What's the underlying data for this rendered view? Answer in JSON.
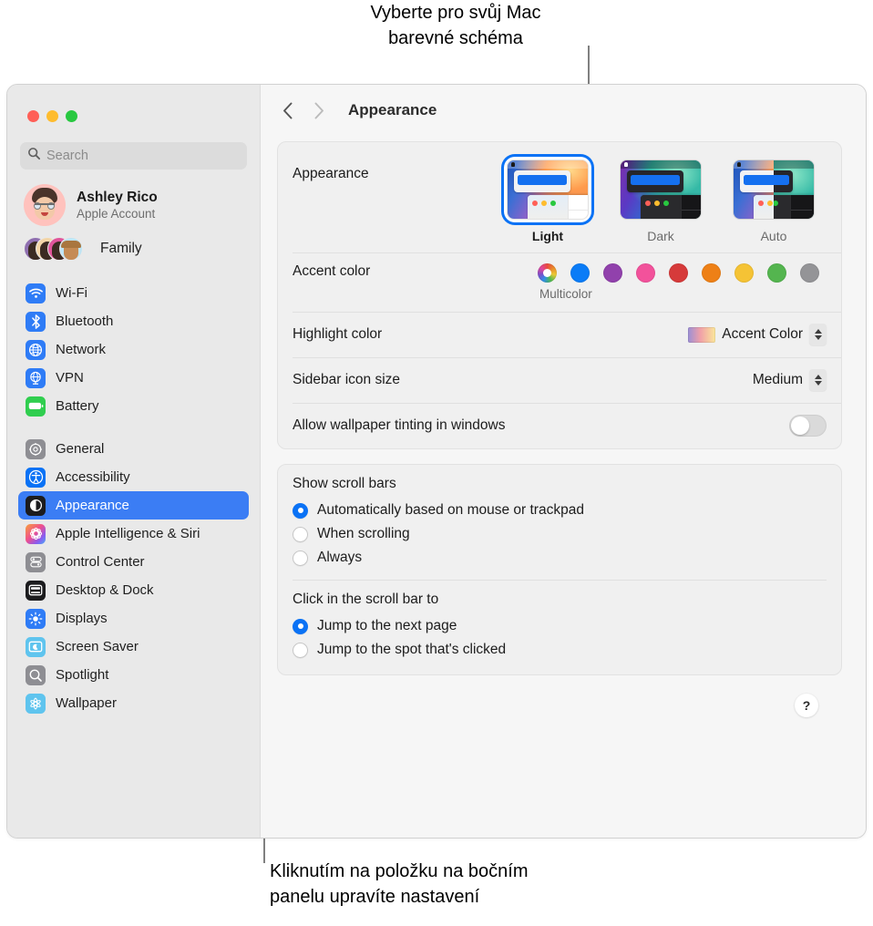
{
  "callouts": {
    "top": "Vyberte pro svůj Mac\nbarevné schéma",
    "bottom": "Kliknutím na položku na bočním\npanelu upravíte nastavení"
  },
  "window": {
    "traffic_lights": [
      "close",
      "minimize",
      "zoom"
    ]
  },
  "sidebar": {
    "search": {
      "placeholder": "Search",
      "value": ""
    },
    "account": {
      "name": "Ashley Rico",
      "subtitle": "Apple Account"
    },
    "family": {
      "label": "Family"
    },
    "groups": [
      {
        "items": [
          {
            "label": "Wi-Fi",
            "icon": "wifi-icon",
            "color": "#2f7cf6",
            "selected": false
          },
          {
            "label": "Bluetooth",
            "icon": "bluetooth-icon",
            "color": "#2f7cf6",
            "selected": false
          },
          {
            "label": "Network",
            "icon": "globe-icon",
            "color": "#2f7cf6",
            "selected": false
          },
          {
            "label": "VPN",
            "icon": "vpn-globe-icon",
            "color": "#2f7cf6",
            "selected": false
          },
          {
            "label": "Battery",
            "icon": "battery-icon",
            "color": "#30ce4f",
            "selected": false
          }
        ]
      },
      {
        "items": [
          {
            "label": "General",
            "icon": "gear-icon",
            "color": "#8e8e93",
            "selected": false
          },
          {
            "label": "Accessibility",
            "icon": "accessibility-icon",
            "color": "#0a72f5",
            "selected": false
          },
          {
            "label": "Appearance",
            "icon": "appearance-icon",
            "color": "#1c1c1e",
            "selected": true
          },
          {
            "label": "Apple Intelligence & Siri",
            "icon": "siri-icon",
            "color": "#e8e8ea",
            "selected": false
          },
          {
            "label": "Control Center",
            "icon": "control-center-icon",
            "color": "#8e8e93",
            "selected": false
          },
          {
            "label": "Desktop & Dock",
            "icon": "desktop-dock-icon",
            "color": "#1c1c1e",
            "selected": false
          },
          {
            "label": "Displays",
            "icon": "displays-icon",
            "color": "#2f7cf6",
            "selected": false
          },
          {
            "label": "Screen Saver",
            "icon": "screen-saver-icon",
            "color": "#5fc4ee",
            "selected": false
          },
          {
            "label": "Spotlight",
            "icon": "spotlight-icon",
            "color": "#8e8e93",
            "selected": false
          },
          {
            "label": "Wallpaper",
            "icon": "wallpaper-icon",
            "color": "#5fc4ee",
            "selected": false
          }
        ]
      }
    ]
  },
  "toolbar": {
    "back": "back-chevron",
    "forward": "forward-chevron",
    "title": "Appearance"
  },
  "main": {
    "appearance": {
      "label": "Appearance",
      "options": [
        {
          "name": "Light",
          "selected": true
        },
        {
          "name": "Dark",
          "selected": false
        },
        {
          "name": "Auto",
          "selected": false
        }
      ]
    },
    "accent": {
      "label": "Accent color",
      "caption": "Multicolor",
      "swatches": [
        {
          "name": "Multicolor",
          "color": "multicolor",
          "selected": true
        },
        {
          "name": "Blue",
          "color": "#0a7cf7"
        },
        {
          "name": "Purple",
          "color": "#9141ac"
        },
        {
          "name": "Pink",
          "color": "#f2529b"
        },
        {
          "name": "Red",
          "color": "#d63a3a"
        },
        {
          "name": "Orange",
          "color": "#ee8016"
        },
        {
          "name": "Yellow",
          "color": "#f5c335"
        },
        {
          "name": "Green",
          "color": "#54b54f"
        },
        {
          "name": "Graphite",
          "color": "#949497"
        }
      ]
    },
    "highlight": {
      "label": "Highlight color",
      "value": "Accent Color"
    },
    "sidebar_icon_size": {
      "label": "Sidebar icon size",
      "value": "Medium"
    },
    "wallpaper_tinting": {
      "label": "Allow wallpaper tinting in windows",
      "on": false
    },
    "scroll_bars": {
      "heading": "Show scroll bars",
      "options": [
        {
          "label": "Automatically based on mouse or trackpad",
          "selected": true
        },
        {
          "label": "When scrolling",
          "selected": false
        },
        {
          "label": "Always",
          "selected": false
        }
      ]
    },
    "scroll_click": {
      "heading": "Click in the scroll bar to",
      "options": [
        {
          "label": "Jump to the next page",
          "selected": true
        },
        {
          "label": "Jump to the spot that's clicked",
          "selected": false
        }
      ]
    },
    "help": "?"
  }
}
